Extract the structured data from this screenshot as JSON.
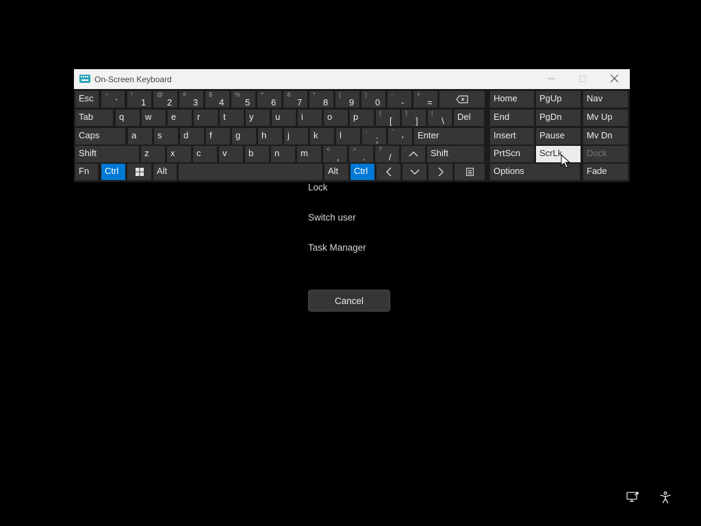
{
  "window": {
    "title": "On-Screen Keyboard",
    "controls": {
      "minimize": "minimize-icon",
      "maximize": "maximize-icon",
      "close": "close-icon"
    }
  },
  "keyboard": {
    "accent_color": "#0078d4",
    "rows": [
      [
        {
          "id": "esc",
          "label": "Esc"
        },
        {
          "id": "backtick",
          "main": "`",
          "shift": "~"
        },
        {
          "id": "1",
          "main": "1",
          "shift": "!"
        },
        {
          "id": "2",
          "main": "2",
          "shift": "@"
        },
        {
          "id": "3",
          "main": "3",
          "shift": "#"
        },
        {
          "id": "4",
          "main": "4",
          "shift": "$"
        },
        {
          "id": "5",
          "main": "5",
          "shift": "%"
        },
        {
          "id": "6",
          "main": "6",
          "shift": "^"
        },
        {
          "id": "7",
          "main": "7",
          "shift": "&"
        },
        {
          "id": "8",
          "main": "8",
          "shift": "*"
        },
        {
          "id": "9",
          "main": "9",
          "shift": "("
        },
        {
          "id": "0",
          "main": "0",
          "shift": ")"
        },
        {
          "id": "minus",
          "main": "-",
          "shift": "-"
        },
        {
          "id": "equals",
          "main": "=",
          "shift": "+"
        },
        {
          "id": "backspace",
          "icon": "backspace-icon"
        },
        {
          "id": "home",
          "label": "Home"
        },
        {
          "id": "pgup",
          "label": "PgUp"
        },
        {
          "id": "nav",
          "label": "Nav"
        }
      ],
      [
        {
          "id": "tab",
          "label": "Tab"
        },
        {
          "id": "q",
          "label": "q"
        },
        {
          "id": "w",
          "label": "w"
        },
        {
          "id": "e",
          "label": "e"
        },
        {
          "id": "r",
          "label": "r"
        },
        {
          "id": "t",
          "label": "t"
        },
        {
          "id": "y",
          "label": "y"
        },
        {
          "id": "u",
          "label": "u"
        },
        {
          "id": "i",
          "label": "i"
        },
        {
          "id": "o",
          "label": "o"
        },
        {
          "id": "p",
          "label": "p"
        },
        {
          "id": "lbracket",
          "main": "[",
          "shift": "{"
        },
        {
          "id": "rbracket",
          "main": "]",
          "shift": "}"
        },
        {
          "id": "backslash",
          "main": "\\",
          "shift": "|"
        },
        {
          "id": "del",
          "label": "Del"
        },
        {
          "id": "end",
          "label": "End"
        },
        {
          "id": "pgdn",
          "label": "PgDn"
        },
        {
          "id": "mvup",
          "label": "Mv Up"
        }
      ],
      [
        {
          "id": "caps",
          "label": "Caps"
        },
        {
          "id": "a",
          "label": "a"
        },
        {
          "id": "s",
          "label": "s"
        },
        {
          "id": "d",
          "label": "d"
        },
        {
          "id": "f",
          "label": "f"
        },
        {
          "id": "g",
          "label": "g"
        },
        {
          "id": "h",
          "label": "h"
        },
        {
          "id": "j",
          "label": "j"
        },
        {
          "id": "k",
          "label": "k"
        },
        {
          "id": "l",
          "label": "l"
        },
        {
          "id": "semicolon",
          "main": ";",
          "shift": ":"
        },
        {
          "id": "quote",
          "main": "'",
          "shift": "\""
        },
        {
          "id": "enter",
          "label": "Enter"
        },
        {
          "id": "insert",
          "label": "Insert"
        },
        {
          "id": "pause",
          "label": "Pause"
        },
        {
          "id": "mvdn",
          "label": "Mv Dn"
        }
      ],
      [
        {
          "id": "lshift",
          "label": "Shift"
        },
        {
          "id": "z",
          "label": "z"
        },
        {
          "id": "x",
          "label": "x"
        },
        {
          "id": "c",
          "label": "c"
        },
        {
          "id": "v",
          "label": "v"
        },
        {
          "id": "b",
          "label": "b"
        },
        {
          "id": "n",
          "label": "n"
        },
        {
          "id": "m",
          "label": "m"
        },
        {
          "id": "comma",
          "main": ",",
          "shift": "<"
        },
        {
          "id": "period",
          "main": ".",
          "shift": ">"
        },
        {
          "id": "slash",
          "main": "/",
          "shift": "?"
        },
        {
          "id": "up",
          "icon": "chevron-up-icon"
        },
        {
          "id": "rshift",
          "label": "Shift"
        },
        {
          "id": "prtscn",
          "label": "PrtScn"
        },
        {
          "id": "scrlk",
          "label": "ScrLk"
        },
        {
          "id": "dock",
          "label": "Dock"
        }
      ],
      [
        {
          "id": "fn",
          "label": "Fn"
        },
        {
          "id": "lctrl",
          "label": "Ctrl"
        },
        {
          "id": "win",
          "icon": "windows-logo-icon"
        },
        {
          "id": "lalt",
          "label": "Alt"
        },
        {
          "id": "space",
          "label": ""
        },
        {
          "id": "ralt",
          "label": "Alt"
        },
        {
          "id": "rctrl",
          "label": "Ctrl"
        },
        {
          "id": "left",
          "icon": "chevron-left-icon"
        },
        {
          "id": "down",
          "icon": "chevron-down-icon"
        },
        {
          "id": "right",
          "icon": "chevron-right-icon"
        },
        {
          "id": "menu",
          "icon": "menu-key-icon"
        },
        {
          "id": "options",
          "label": "Options"
        },
        {
          "id": "fade",
          "label": "Fade"
        }
      ]
    ]
  },
  "security_menu": {
    "items": [
      "Lock",
      "Switch user",
      "Task Manager"
    ],
    "cancel_label": "Cancel"
  },
  "corner_icons": [
    "network-icon",
    "accessibility-icon"
  ]
}
